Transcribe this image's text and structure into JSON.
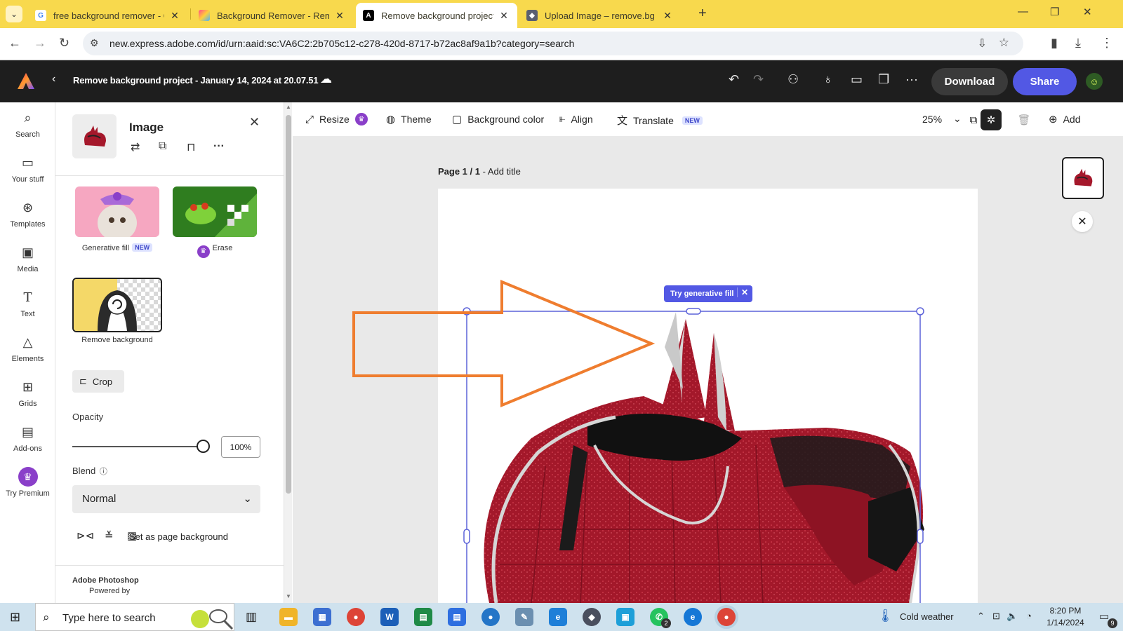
{
  "browser": {
    "tabs": [
      {
        "title": "free background remover - Goo",
        "favicon": "google-icon",
        "active": false
      },
      {
        "title": "Background Remover - Remove",
        "favicon": "colorful-icon",
        "active": false
      },
      {
        "title": "Remove background project - A",
        "favicon": "adobe-express-icon",
        "active": true
      },
      {
        "title": "Upload Image – remove.bg",
        "favicon": "removebg-icon",
        "active": false
      }
    ],
    "url": "new.express.adobe.com/id/urn:aaid:sc:VA6C2:2b705c12-c278-420d-8717-b72ac8af9a1b?category=search",
    "accent": "#f8d94d"
  },
  "header": {
    "doc_title": "Remove background project - January 14, 2024 at 20.07.51",
    "download_label": "Download",
    "share_label": "Share",
    "share_color": "#5258e4"
  },
  "rail": {
    "items": [
      {
        "label": "Search",
        "icon": "search-icon"
      },
      {
        "label": "Your stuff",
        "icon": "folder-icon"
      },
      {
        "label": "Templates",
        "icon": "templates-icon"
      },
      {
        "label": "Media",
        "icon": "media-icon"
      },
      {
        "label": "Text",
        "icon": "text-icon"
      },
      {
        "label": "Elements",
        "icon": "elements-icon"
      },
      {
        "label": "Grids",
        "icon": "grids-icon"
      },
      {
        "label": "Add-ons",
        "icon": "addons-icon"
      },
      {
        "label": "Try Premium",
        "icon": "crown-icon"
      }
    ]
  },
  "panel": {
    "title": "Image",
    "cards": [
      {
        "label": "Generative fill",
        "badge": "NEW"
      },
      {
        "label": "Erase"
      },
      {
        "label": "Remove background"
      }
    ],
    "crop_label": "Crop",
    "opacity_label": "Opacity",
    "opacity_value": "100%",
    "opacity_fraction": 1.0,
    "blend_label": "Blend",
    "blend_value": "Normal",
    "set_bg_label": "Set as page background",
    "powered_prefix": "Powered by ",
    "powered_brand": "Adobe Photoshop"
  },
  "toolbar": {
    "resize": "Resize",
    "theme": "Theme",
    "bg_color": "Background color",
    "align": "Align",
    "translate": "Translate",
    "translate_badge": "NEW",
    "zoom": "25%",
    "add": "Add"
  },
  "canvas": {
    "page_label_bold": "Page 1 / 1",
    "page_label_rest": " - Add title",
    "gen_fill_pill": "Try generative fill"
  },
  "taskbar": {
    "search_placeholder": "Type here to search",
    "weather": "Cold weather",
    "time": "8:20 PM",
    "date": "1/14/2024",
    "notifications": "9",
    "whatsapp_badge": "2"
  }
}
